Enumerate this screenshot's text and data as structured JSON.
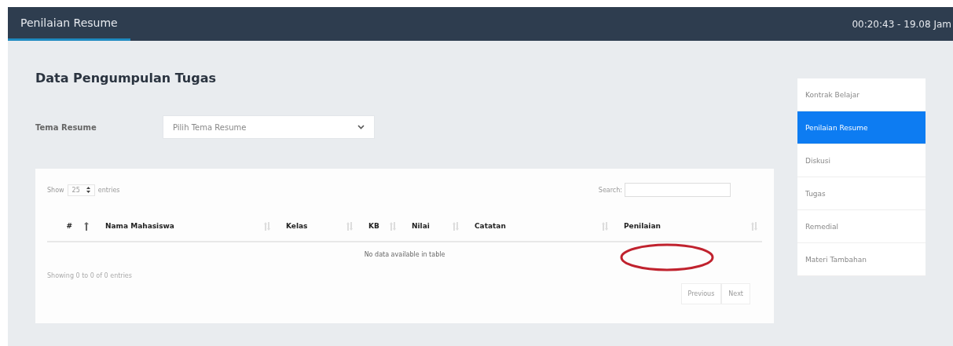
{
  "navbar": {
    "tabs": [
      {
        "label": "Penilaian Resume",
        "selected": true
      }
    ],
    "clock": "00:20:43 - 19.08 Jam"
  },
  "page": {
    "title": "Data Pengumpulan Tugas",
    "filter": {
      "label": "Tema Resume",
      "placeholder": "Pilih Tema Resume"
    },
    "table": {
      "length_label_before": "Show",
      "length_value": "25",
      "length_label_after": "entries",
      "search_label": "Search:",
      "columns": [
        {
          "label": "#",
          "sorted": true
        },
        {
          "label": "Nama Mahasiswa",
          "sorted": false
        },
        {
          "label": "Kelas",
          "sorted": false
        },
        {
          "label": "KB",
          "sorted": false
        },
        {
          "label": "Nilai",
          "sorted": false
        },
        {
          "label": "Catatan",
          "sorted": false
        },
        {
          "label": "Penilaian",
          "sorted": false
        }
      ],
      "empty_message": "No data available in table",
      "info": "Showing 0 to 0 of 0 entries",
      "pagination": [
        "Previous",
        "Next"
      ]
    }
  },
  "sidebar": {
    "items": [
      {
        "label": "Kontrak Belajar",
        "selected": false
      },
      {
        "label": "Penilaian Resume",
        "selected": true
      },
      {
        "label": "Diskusi",
        "selected": false
      },
      {
        "label": "Tugas",
        "selected": false
      },
      {
        "label": "Remedial",
        "selected": false
      },
      {
        "label": "Materi Tambahan",
        "selected": false
      }
    ]
  }
}
